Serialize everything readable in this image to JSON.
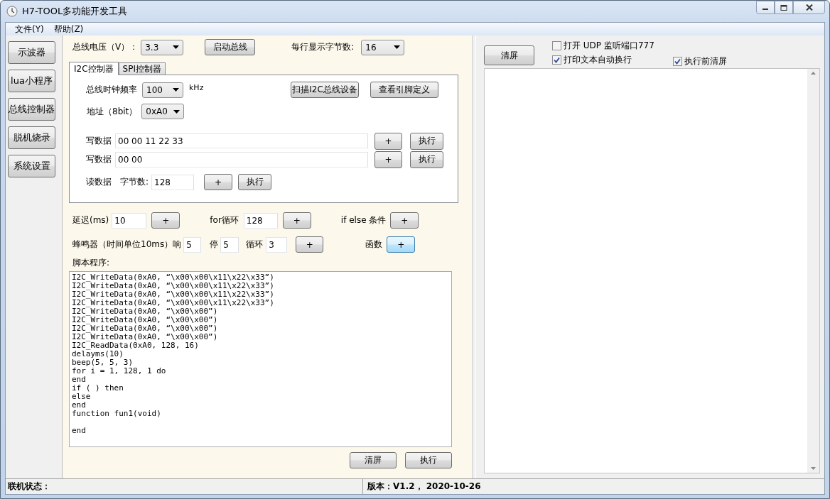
{
  "window": {
    "title": "H7-TOOL多功能开发工具"
  },
  "menu": [
    {
      "label": "文件(Y)"
    },
    {
      "label": "帮助(Z)"
    }
  ],
  "nav": [
    {
      "label": "示波器"
    },
    {
      "label": "lua小程序"
    },
    {
      "label": "总线控制器"
    },
    {
      "label": "脱机烧录"
    },
    {
      "label": "系统设置"
    }
  ],
  "bus": {
    "voltage_label": "总线电压（V）：",
    "voltage": "3.3",
    "start_button": "启动总线",
    "bytes_per_line_label": "每行显示字节数:",
    "bytes_per_line": "16"
  },
  "tabs": [
    {
      "label": "I2C控制器",
      "selected": true
    },
    {
      "label": "SPI控制器",
      "selected": false
    }
  ],
  "i2c": {
    "clock_label": "总线时钟频率",
    "clock": "100",
    "clock_unit": "kHz",
    "scan_button": "扫描I2C总线设备",
    "pins_button": "查看引脚定义",
    "address_label": "地址（8bit）",
    "address": "0xA0",
    "writes": [
      {
        "label": "写数据",
        "value": "00 00 11 22 33",
        "add_button": "+",
        "run_button": "执行"
      },
      {
        "label": "写数据",
        "value": "00 00",
        "add_button": "+",
        "run_button": "执行"
      }
    ],
    "read": {
      "label": "读数据",
      "count_label": "字节数:",
      "count": "128",
      "add_button": "+",
      "run_button": "执行"
    }
  },
  "snippets": {
    "delay_label": "延迟(ms)",
    "delay": "10",
    "delay_button": "+",
    "for_label": "for循环",
    "for_count": "128",
    "for_button": "+",
    "if_label": "if else 条件",
    "if_button": "+",
    "beep_label": "蜂鸣器（时间单位10ms）响",
    "beep_on": "5",
    "beep_off_label": "停",
    "beep_off": "5",
    "beep_loop_label": "循环",
    "beep_loop": "3",
    "beep_button": "+",
    "function_label": "函数",
    "function_button": "+",
    "function_highlighted": true
  },
  "script": {
    "label": "脚本程序:",
    "lines": [
      "I2C_WriteData(0xA0, “\\x00\\x00\\x11\\x22\\x33”)",
      "I2C_WriteData(0xA0, “\\x00\\x00\\x11\\x22\\x33”)",
      "I2C_WriteData(0xA0, “\\x00\\x00\\x11\\x22\\x33”)",
      "I2C_WriteData(0xA0, “\\x00\\x00\\x11\\x22\\x33”)",
      "I2C_WriteData(0xA0, “\\x00\\x00”)",
      "I2C_WriteData(0xA0, “\\x00\\x00”)",
      "I2C_WriteData(0xA0, “\\x00\\x00”)",
      "I2C_WriteData(0xA0, “\\x00\\x00”)",
      "I2C_ReadData(0xA0, 128, 16)",
      "delayms(10)",
      "beep(5, 5, 3)",
      "for i = 1, 128, 1 do",
      "end",
      "if ( ) then",
      "else",
      "end",
      "function fun1(void)",
      {
        "text": "end",
        "blank_line_before": true
      }
    ],
    "clear_button": "清屏",
    "run_button": "执行"
  },
  "output": {
    "clear_button": "清屏",
    "options": [
      {
        "label": "打开 UDP 监听端口777",
        "checked": false
      },
      {
        "label": "打印文本自动换行",
        "checked": true
      },
      {
        "label": "执行前清屏",
        "checked": true
      }
    ]
  },
  "status_bar": {
    "connection_label": "联机状态：",
    "version": "版本：V1.2， 2020-10-26"
  }
}
